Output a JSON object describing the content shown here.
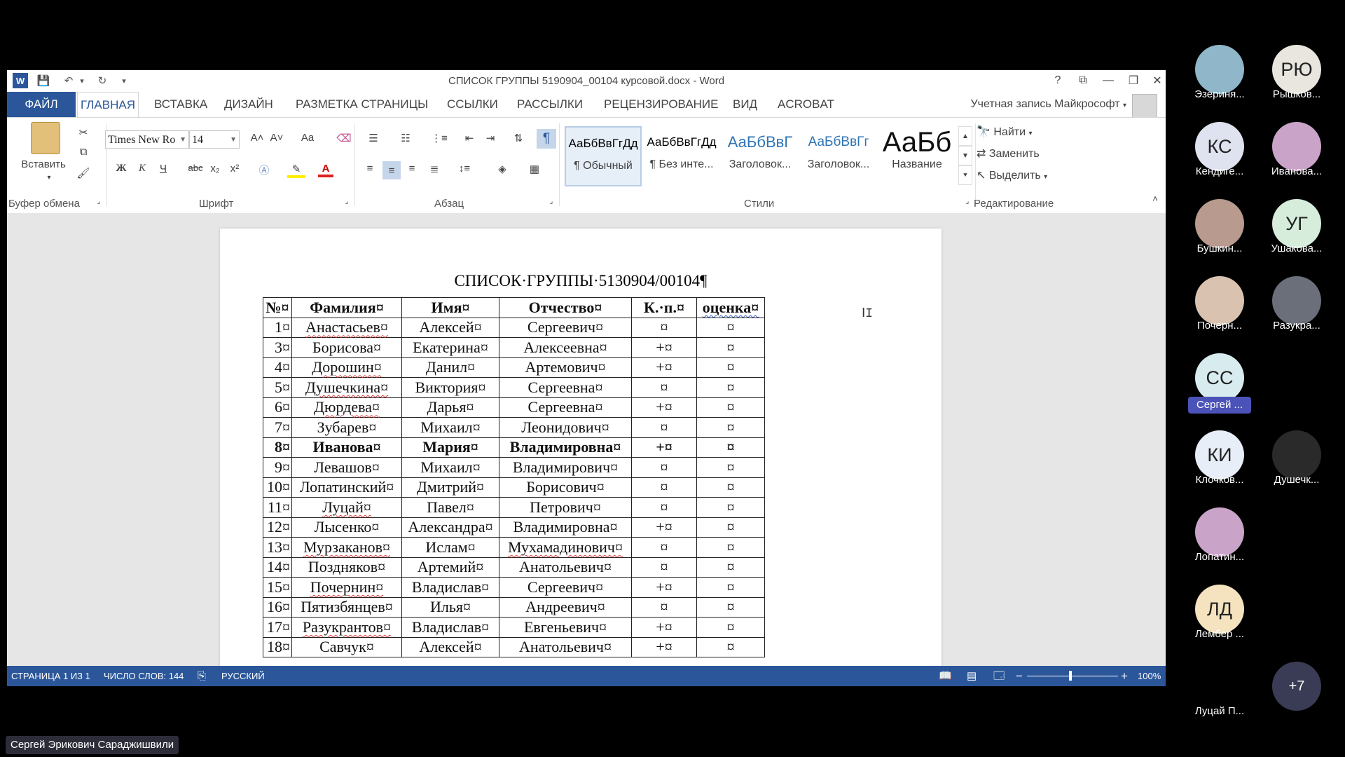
{
  "window": {
    "title": "СПИСОК ГРУППЫ 5190904_00104 курсовой.docx - Word",
    "help": "?",
    "ribbon_display": "⧉",
    "minimize": "—",
    "restore": "❐",
    "close": "✕"
  },
  "quick_access": {
    "word_icon": "W",
    "save": "💾",
    "undo": "↶",
    "undo_dd": "▾",
    "redo": "↻",
    "customize": "▾"
  },
  "tabs": [
    "ФАЙЛ",
    "ГЛАВНАЯ",
    "ВСТАВКА",
    "ДИЗАЙН",
    "РАЗМЕТКА СТРАНИЦЫ",
    "ССЫЛКИ",
    "РАССЫЛКИ",
    "РЕЦЕНЗИРОВАНИЕ",
    "ВИД",
    "ACROBAT"
  ],
  "account_label": "Учетная запись Майкрософт",
  "ribbon": {
    "clipboard": {
      "paste": "Вставить",
      "group": "Буфер обмена"
    },
    "font": {
      "font_name": "Times New Ro",
      "font_size": "14",
      "bold": "Ж",
      "italic": "К",
      "underline": "Ч",
      "strike": "abc",
      "sub": "x₂",
      "sup": "x²",
      "grow": "A˄",
      "shrink": "A˅",
      "case": "Aa",
      "color_letter": "A",
      "group": "Шрифт"
    },
    "paragraph": {
      "group": "Абзац",
      "pilcrow": "¶"
    },
    "styles": {
      "group": "Стили",
      "items": [
        {
          "sample": "АаБбВвГгДд",
          "name": "¶ Обычный"
        },
        {
          "sample": "АаБбВвГгДд",
          "name": "¶ Без инте..."
        },
        {
          "sample": "АаБбВвГ",
          "name": "Заголовок..."
        },
        {
          "sample": "АаБбВвГг",
          "name": "Заголовок..."
        },
        {
          "sample": "АаБб",
          "name": "Название"
        }
      ]
    },
    "editing": {
      "find": "Найти",
      "replace": "Заменить",
      "select": "Выделить",
      "group": "Редактирование"
    }
  },
  "document": {
    "title": "СПИСОК·ГРУППЫ·5130904/00104¶",
    "headers": [
      "№¤",
      "Фамилия¤",
      "Имя¤",
      "Отчество¤",
      "К.·п.¤",
      "оценка¤"
    ],
    "rows": [
      [
        "1¤",
        "Анастасьев¤",
        "Алексей¤",
        "Сергеевич¤",
        "¤",
        "¤"
      ],
      [
        "3¤",
        "Борисова¤",
        "Екатерина¤",
        "Алексеевна¤",
        "+¤",
        "¤"
      ],
      [
        "4¤",
        "Дорошин¤",
        "Данил¤",
        "Артемович¤",
        "+¤",
        "¤"
      ],
      [
        "5¤",
        "Душечкина¤",
        "Виктория¤",
        "Сергеевна¤",
        "¤",
        "¤"
      ],
      [
        "6¤",
        "Дюрдева¤",
        "Дарья¤",
        "Сергеевна¤",
        "+¤",
        "¤"
      ],
      [
        "7¤",
        "Зубарев¤",
        "Михаил¤",
        "Леонидович¤",
        "¤",
        "¤"
      ],
      [
        "8¤",
        "Иванова¤",
        "Мария¤",
        "Владимировна¤",
        "+¤",
        "¤"
      ],
      [
        "9¤",
        "Левашов¤",
        "Михаил¤",
        "Владимирович¤",
        "¤",
        "¤"
      ],
      [
        "10¤",
        "Лопатинский¤",
        "Дмитрий¤",
        "Борисович¤",
        "¤",
        "¤"
      ],
      [
        "11¤",
        "Луцай¤",
        "Павел¤",
        "Петрович¤",
        "¤",
        "¤"
      ],
      [
        "12¤",
        "Лысенко¤",
        "Александра¤",
        "Владимировна¤",
        "+¤",
        "¤"
      ],
      [
        "13¤",
        "Мурзаканов¤",
        "Ислам¤",
        "Мухамадинович¤",
        "¤",
        "¤"
      ],
      [
        "14¤",
        "Поздняков¤",
        "Артемий¤",
        "Анатольевич¤",
        "¤",
        "¤"
      ],
      [
        "15¤",
        "Почернин¤",
        "Владислав¤",
        "Сергеевич¤",
        "+¤",
        "¤"
      ],
      [
        "16¤",
        "Пятизбянцев¤",
        "Илья¤",
        "Андреевич¤",
        "¤",
        "¤"
      ],
      [
        "17¤",
        "Разукрантов¤",
        "Владислав¤",
        "Евгеньевич¤",
        "+¤",
        "¤"
      ],
      [
        "18¤",
        "Савчук¤",
        "Алексей¤",
        "Анатольевич¤",
        "+¤",
        "¤"
      ]
    ]
  },
  "status": {
    "page": "СТРАНИЦА 1 ИЗ 1",
    "words": "ЧИСЛО СЛОВ: 144",
    "language": "РУССКИЙ",
    "zoom": "100%",
    "zoom_minus": "−",
    "zoom_plus": "+"
  },
  "participants": [
    {
      "initials": "",
      "name": "Эзериня...",
      "color": "#8fb6c9"
    },
    {
      "initials": "РЮ",
      "name": "Рышков...",
      "color": "#e9e6e0"
    },
    {
      "initials": "КС",
      "name": "Кендиге...",
      "color": "#dfe3ef"
    },
    {
      "initials": "",
      "name": "Иванова...",
      "color": "#c9a3c8"
    },
    {
      "initials": "",
      "name": "Бушкин...",
      "color": "#b89a8e"
    },
    {
      "initials": "УГ",
      "name": "Ушакова...",
      "color": "#d6eddc"
    },
    {
      "initials": "",
      "name": "Почерн...",
      "color": "#d9c3b0"
    },
    {
      "initials": "",
      "name": "Разукра...",
      "color": "#6b6f7a"
    },
    {
      "initials": "СС",
      "name": "Сергей ...",
      "color": "#d8ecef"
    },
    {
      "initials": "КИ",
      "name": "Клочков...",
      "color": "#e8eef7"
    },
    {
      "initials": "",
      "name": "Душечк...",
      "color": "#2a2a2a"
    },
    {
      "initials": "",
      "name": "Лопатин...",
      "color": "#c9a3c8"
    },
    {
      "initials": "ЛД",
      "name": "Лембер ...",
      "color": "#f5e3bf"
    },
    {
      "initials": "+7",
      "name": "",
      "color": "#3a3b54"
    },
    {
      "initials": "",
      "name": "Луцай П...",
      "color": "#000000"
    }
  ],
  "presenter_label": "Сергей Эрикович Сараджишвили"
}
